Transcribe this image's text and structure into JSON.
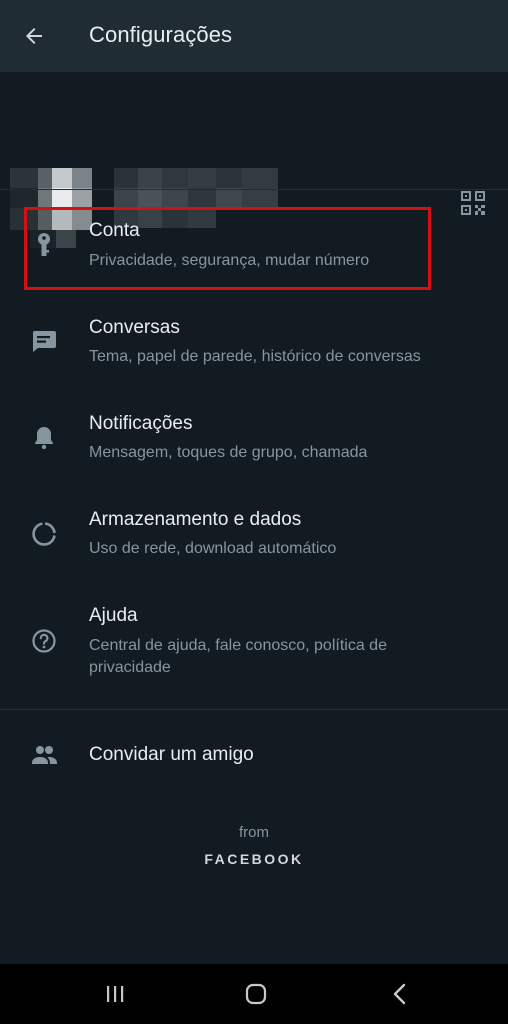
{
  "appbar": {
    "title": "Configurações",
    "back_icon": "arrow-back-icon"
  },
  "profile": {
    "qr_icon": "qr-code-icon"
  },
  "settings": [
    {
      "id": "account",
      "icon": "key-icon",
      "title": "Conta",
      "subtitle": "Privacidade, segurança, mudar número"
    },
    {
      "id": "chats",
      "icon": "chat-icon",
      "title": "Conversas",
      "subtitle": "Tema, papel de parede, histórico de conversas"
    },
    {
      "id": "notifications",
      "icon": "bell-icon",
      "title": "Notificações",
      "subtitle": "Mensagem, toques de grupo, chamada"
    },
    {
      "id": "storage",
      "icon": "data-usage-icon",
      "title": "Armazenamento e dados",
      "subtitle": "Uso de rede, download automático"
    },
    {
      "id": "help",
      "icon": "help-icon",
      "title": "Ajuda",
      "subtitle": "Central de ajuda, fale conosco, política de privacidade"
    }
  ],
  "invite": {
    "icon": "people-icon",
    "title": "Convidar um amigo"
  },
  "footer": {
    "from": "from",
    "brand": "FACEBOOK"
  },
  "colors": {
    "background": "#121b22",
    "appbar": "#1f2c33",
    "icon": "#8696a0",
    "title_text": "#e9edef",
    "subtitle_text": "#8696a0",
    "highlight_border": "#d60f14"
  },
  "system_nav": {
    "recents_icon": "recents-icon",
    "home_icon": "home-icon",
    "back_icon": "nav-back-icon"
  }
}
